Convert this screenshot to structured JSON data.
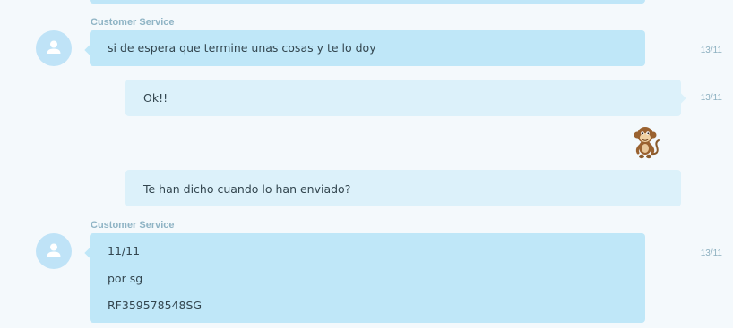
{
  "messages": [
    {
      "sender": "Customer Service",
      "text": "si de espera que termine unas cosas y te lo doy",
      "time": "13/11"
    },
    {
      "text": "Ok!!",
      "time": "13/11"
    },
    {
      "sticker": "monkey-sticker"
    },
    {
      "text": "Te han dicho cuando lo han enviado?"
    },
    {
      "sender": "Customer Service",
      "lines": [
        "11/11",
        "por sg",
        "RF359578548SG"
      ],
      "time": "13/11"
    }
  ],
  "icons": {
    "avatar": "user-icon",
    "sticker": "monkey-sticker-icon"
  },
  "colors": {
    "background": "#f4f9fc",
    "incoming_bubble": "#bfe7f8",
    "outgoing_bubble": "#dcf1fa",
    "avatar": "#bfe3f7",
    "sender_name": "#8fb4c5",
    "timestamp": "#8db0c0",
    "message_text": "#33464f"
  }
}
